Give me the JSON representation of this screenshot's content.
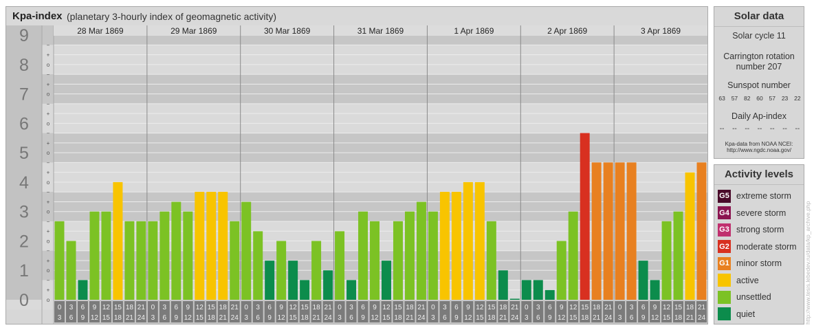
{
  "header": {
    "title": "Kpa-index",
    "subtitle": "(planetary 3-hourly index of geomagnetic activity)"
  },
  "chart_data": {
    "type": "bar",
    "days": [
      "28 Mar 1869",
      "29 Mar 1869",
      "30 Mar 1869",
      "31 Mar 1869",
      "1 Apr 1869",
      "2 Apr 1869",
      "3 Apr 1869"
    ],
    "interval_top": [
      "0",
      "3",
      "6",
      "9",
      "12",
      "15",
      "18",
      "21"
    ],
    "interval_bottom": [
      "3",
      "6",
      "9",
      "12",
      "15",
      "18",
      "21",
      "24"
    ],
    "y_labels": [
      "0",
      "1",
      "2",
      "3",
      "4",
      "5",
      "6",
      "7",
      "8",
      "9"
    ],
    "ylim": [
      0,
      9.33
    ],
    "values": [
      2.67,
      2.0,
      0.67,
      3.0,
      3.0,
      4.0,
      2.67,
      2.67,
      2.67,
      3.0,
      3.33,
      3.0,
      3.67,
      3.67,
      3.67,
      2.67,
      3.33,
      2.33,
      1.33,
      2.0,
      1.33,
      0.67,
      2.0,
      1.0,
      2.33,
      0.67,
      3.0,
      2.67,
      1.33,
      2.67,
      3.0,
      3.33,
      3.0,
      3.67,
      3.67,
      4.0,
      4.0,
      2.67,
      1.0,
      0.0,
      0.67,
      0.67,
      0.33,
      2.0,
      3.0,
      5.67,
      4.67,
      4.67,
      4.67,
      4.67,
      1.33,
      0.67,
      2.67,
      3.0,
      4.33,
      4.67
    ]
  },
  "solar": {
    "title": "Solar data",
    "solar_cycle": "Solar cycle 11",
    "carrington_line1": "Carrington rotation",
    "carrington_line2": "number 207",
    "sunspot_label": "Sunspot number",
    "sunspot_values": [
      "63",
      "57",
      "82",
      "60",
      "57",
      "23",
      "22"
    ],
    "ap_label": "Daily Ap-index",
    "ap_values": [
      "--",
      "--",
      "--",
      "--",
      "--",
      "--",
      "--"
    ],
    "source_line1": "Kpa-data from NOAA NCEI:",
    "source_line2": "http://www.ngdc.noaa.gov/"
  },
  "activity": {
    "title": "Activity levels",
    "items": [
      {
        "code": "G5",
        "label": "extreme storm",
        "color": "#4a0a2a"
      },
      {
        "code": "G4",
        "label": "severe storm",
        "color": "#8b1450"
      },
      {
        "code": "G3",
        "label": "strong storm",
        "color": "#c0306e"
      },
      {
        "code": "G2",
        "label": "moderate storm",
        "color": "#d83020"
      },
      {
        "code": "G1",
        "label": "minor storm",
        "color": "#e88020"
      },
      {
        "code": "",
        "label": "active",
        "color": "#f8c400"
      },
      {
        "code": "",
        "label": "unsettled",
        "color": "#7cc224"
      },
      {
        "code": "",
        "label": "quiet",
        "color": "#0c8c4c"
      }
    ]
  },
  "colors": {
    "quiet": "#0c8c4c",
    "unsettled": "#7cc224",
    "active": "#f8c400",
    "minor_storm": "#e88020",
    "moderate_storm": "#d83020"
  },
  "watermark": "http://www.tesis.lebedev.ru/data/kp_archive.php"
}
